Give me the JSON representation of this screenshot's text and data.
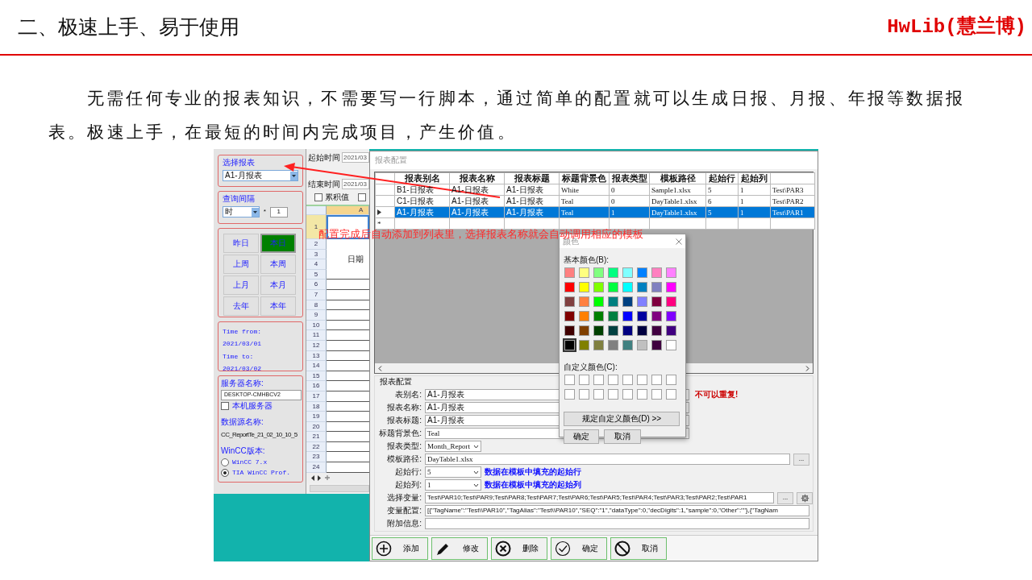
{
  "slide": {
    "title": "二、极速上手、易于使用",
    "brand": "HwLib(慧兰博)",
    "paragraph": "无需任何专业的报表知识，不需要写一行脚本，通过简单的配置就可以生成日报、月报、年报等数据报表。极速上手，在最短的时间内完成项目，产生价值。"
  },
  "main_window": {
    "report_select": {
      "label": "选择报表",
      "value": "A1-月报表"
    },
    "interval": {
      "label": "查询间隔",
      "unit": "时",
      "multiplier": "*",
      "count": "1"
    },
    "period_buttons": [
      {
        "label": "昨日",
        "selected": false
      },
      {
        "label": "本日",
        "selected": true
      },
      {
        "label": "上周",
        "selected": false
      },
      {
        "label": "本周",
        "selected": false
      },
      {
        "label": "上月",
        "selected": false
      },
      {
        "label": "本月",
        "selected": false
      },
      {
        "label": "去年",
        "selected": false
      },
      {
        "label": "本年",
        "selected": false
      }
    ],
    "time_range": {
      "from_label": "Time from:",
      "from": "2021/03/01",
      "to_label": "Time to:",
      "to": "2021/03/02"
    },
    "server": {
      "label": "服务器名称:",
      "value": "DESKTOP-CMHBCV2",
      "local_label": "本机服务器",
      "local_checked": false,
      "datasource_label": "数据源名称:",
      "datasource": "CC_ReportTe_21_02_10_10_5",
      "version_label": "WinCC版本:",
      "versions": [
        {
          "label": "WinCC 7.x",
          "selected": false
        },
        {
          "label": "TIA WinCC Prof.",
          "selected": true
        }
      ]
    },
    "start_time": {
      "label": "起始时间",
      "value": "2021/03"
    },
    "end_time": {
      "label": "结束时间",
      "value": "2021/03"
    },
    "options": [
      {
        "label": "累积值",
        "checked": false
      },
      {
        "checked": false
      }
    ],
    "sheet": {
      "column": "A",
      "row_numbers": [
        "1",
        "2",
        "3",
        "4",
        "5",
        "6",
        "7",
        "8",
        "9",
        "10",
        "11",
        "12",
        "13",
        "14",
        "15",
        "16",
        "17",
        "18",
        "19",
        "20",
        "21",
        "22",
        "23",
        "24"
      ],
      "merged_cell": "日期"
    }
  },
  "config_dialog": {
    "title": "报表配置",
    "grid": {
      "columns": [
        "报表别名",
        "报表名称",
        "报表标题",
        "标题背景色",
        "报表类型",
        "模板路径",
        "起始行",
        "起始列"
      ],
      "rows": [
        {
          "selected": false,
          "cells": [
            "B1-日报表",
            "A1-日报表",
            "A1-日报表",
            "White",
            "0",
            "Sample1.xlsx",
            "5",
            "1",
            "Test\\PAR3"
          ]
        },
        {
          "selected": false,
          "cells": [
            "C1-日报表",
            "A1-日报表",
            "A1-日报表",
            "Teal",
            "0",
            "DayTable1.xlsx",
            "6",
            "1",
            "Test\\PAR2"
          ]
        },
        {
          "selected": true,
          "cells": [
            "A1-月报表",
            "A1-月报表",
            "A1-月报表",
            "Teal",
            "1",
            "DayTable1.xlsx",
            "5",
            "1",
            "Test\\PAR1"
          ]
        }
      ],
      "new_row_marker": "*"
    },
    "form_title": "报表配置",
    "fields": [
      {
        "label": "表别名:",
        "kind": "text",
        "value": "A1-月报表",
        "note": {
          "text": "不可以重复!",
          "color": "#cc0000"
        }
      },
      {
        "label": "报表名称:",
        "kind": "text",
        "value": "A1-月报表"
      },
      {
        "label": "报表标题:",
        "kind": "text",
        "value": "A1-月报表"
      },
      {
        "label": "标题背景色:",
        "kind": "text",
        "value": "Teal"
      },
      {
        "label": "报表类型:",
        "kind": "select",
        "value": "Month_Report"
      },
      {
        "label": "模板路径:",
        "kind": "browse",
        "value": "DayTable1.xlsx",
        "browse": "..."
      },
      {
        "label": "起始行:",
        "kind": "select",
        "value": "5",
        "note": {
          "text": "数据在模板中填充的起始行",
          "color": "#1010ff"
        }
      },
      {
        "label": "起始列:",
        "kind": "select",
        "value": "1",
        "note": {
          "text": "数据在模板中填充的起始列",
          "color": "#1010ff"
        }
      },
      {
        "label": "选择变量:",
        "kind": "browse_config",
        "value": "Test\\PAR10;Test\\PAR9;Test\\PAR8;Test\\PAR7;Test\\PAR6;Test\\PAR5;Test\\PAR4;Test\\PAR3;Test\\PAR2;Test\\PAR1",
        "browse": "..."
      },
      {
        "label": "变量配置:",
        "kind": "long",
        "value": "[{\"TagName\":\"Test\\\\PAR10\",\"TagAlias\":\"Test\\\\PAR10\",\"SEQ\":\"1\",\"dataType\":0,\"decDigits\":1,\"sample\":0,\"Other\":\"\"},{\"TagNam"
      },
      {
        "label": "附加信息:",
        "kind": "long"
      }
    ],
    "buttons": [
      {
        "label": "添加",
        "kind": "plus"
      },
      {
        "label": "修改",
        "kind": "pencil"
      },
      {
        "label": "删除",
        "kind": "cross"
      },
      {
        "label": "确定",
        "kind": "check"
      },
      {
        "label": "取消",
        "kind": "ban"
      }
    ]
  },
  "color_dialog": {
    "title": "颜色",
    "basic_label": "基本颜色(B):",
    "basic_colors": [
      [
        {
          "color": "#ff8080",
          "selected": false
        },
        {
          "color": "#ffff80",
          "selected": false
        },
        {
          "color": "#80ff80",
          "selected": false
        },
        {
          "color": "#00ff80",
          "selected": false
        },
        {
          "color": "#80ffff",
          "selected": false
        },
        {
          "color": "#0080ff",
          "selected": false
        },
        {
          "color": "#ff80c0",
          "selected": false
        },
        {
          "color": "#ff80ff",
          "selected": false
        }
      ],
      [
        {
          "color": "#ff0000",
          "selected": false
        },
        {
          "color": "#ffff00",
          "selected": false
        },
        {
          "color": "#80ff00",
          "selected": false
        },
        {
          "color": "#00ff40",
          "selected": false
        },
        {
          "color": "#00ffff",
          "selected": false
        },
        {
          "color": "#0080c0",
          "selected": false
        },
        {
          "color": "#8080c0",
          "selected": false
        },
        {
          "color": "#ff00ff",
          "selected": false
        }
      ],
      [
        {
          "color": "#804040",
          "selected": false
        },
        {
          "color": "#ff8040",
          "selected": false
        },
        {
          "color": "#00ff00",
          "selected": false
        },
        {
          "color": "#008080",
          "selected": false
        },
        {
          "color": "#004080",
          "selected": false
        },
        {
          "color": "#8080ff",
          "selected": false
        },
        {
          "color": "#800040",
          "selected": false
        },
        {
          "color": "#ff0080",
          "selected": false
        }
      ],
      [
        {
          "color": "#800000",
          "selected": false
        },
        {
          "color": "#ff8000",
          "selected": false
        },
        {
          "color": "#008000",
          "selected": false
        },
        {
          "color": "#008040",
          "selected": false
        },
        {
          "color": "#0000ff",
          "selected": false
        },
        {
          "color": "#0000a0",
          "selected": false
        },
        {
          "color": "#800080",
          "selected": false
        },
        {
          "color": "#8000ff",
          "selected": false
        }
      ],
      [
        {
          "color": "#400000",
          "selected": false
        },
        {
          "color": "#804000",
          "selected": false
        },
        {
          "color": "#004000",
          "selected": false
        },
        {
          "color": "#004040",
          "selected": false
        },
        {
          "color": "#000080",
          "selected": false
        },
        {
          "color": "#000040",
          "selected": false
        },
        {
          "color": "#400040",
          "selected": false
        },
        {
          "color": "#400080",
          "selected": false
        }
      ],
      [
        {
          "color": "#000000",
          "selected": true
        },
        {
          "color": "#808000",
          "selected": false
        },
        {
          "color": "#808040",
          "selected": false
        },
        {
          "color": "#808080",
          "selected": false
        },
        {
          "color": "#408080",
          "selected": false
        },
        {
          "color": "#c0c0c0",
          "selected": false
        },
        {
          "color": "#400040",
          "selected": false
        },
        {
          "color": "#ffffff",
          "selected": false
        }
      ]
    ],
    "custom_label": "自定义颜色(C):",
    "custom_colors": [
      {
        "color": "#ffffff"
      },
      {
        "color": "#ffffff"
      },
      {
        "color": "#ffffff"
      },
      {
        "color": "#ffffff"
      },
      {
        "color": "#ffffff"
      },
      {
        "color": "#ffffff"
      },
      {
        "color": "#ffffff"
      },
      {
        "color": "#ffffff"
      },
      {
        "color": "#ffffff"
      },
      {
        "color": "#ffffff"
      },
      {
        "color": "#ffffff"
      },
      {
        "color": "#ffffff"
      },
      {
        "color": "#ffffff"
      },
      {
        "color": "#ffffff"
      },
      {
        "color": "#ffffff"
      },
      {
        "color": "#ffffff"
      }
    ],
    "define_button": "规定自定义颜色(D) >>",
    "ok": "确定",
    "cancel": "取消"
  },
  "annotation": "配置完成后自动添加到列表里，选择报表名称就会自动调用相应的模板"
}
